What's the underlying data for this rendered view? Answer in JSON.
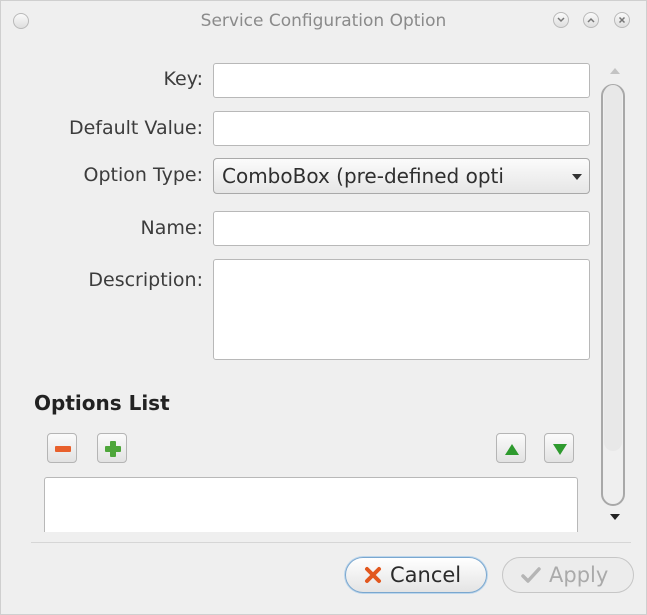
{
  "window": {
    "title": "Service Configuration Option"
  },
  "form": {
    "key_label": "Key:",
    "key_value": "",
    "default_label": "Default Value:",
    "default_value": "",
    "type_label": "Option Type:",
    "type_value": "ComboBox (pre-defined opti",
    "name_label": "Name:",
    "name_value": "",
    "description_label": "Description:",
    "description_value": ""
  },
  "options_list": {
    "title": "Options List",
    "items": []
  },
  "buttons": {
    "cancel": "Cancel",
    "apply": "Apply"
  },
  "colors": {
    "remove_icon": "#e8602c",
    "add_icon": "#4ea63a",
    "arrow_icons": "#2e9a2e",
    "cancel_icon": "#e2571e",
    "focus_border": "#7aa7cf"
  },
  "icons": {
    "remove": "minus-icon",
    "add": "plus-icon",
    "up": "triangle-up-icon",
    "down": "triangle-down-icon",
    "cancel": "x-icon",
    "apply": "checkmark-icon"
  }
}
